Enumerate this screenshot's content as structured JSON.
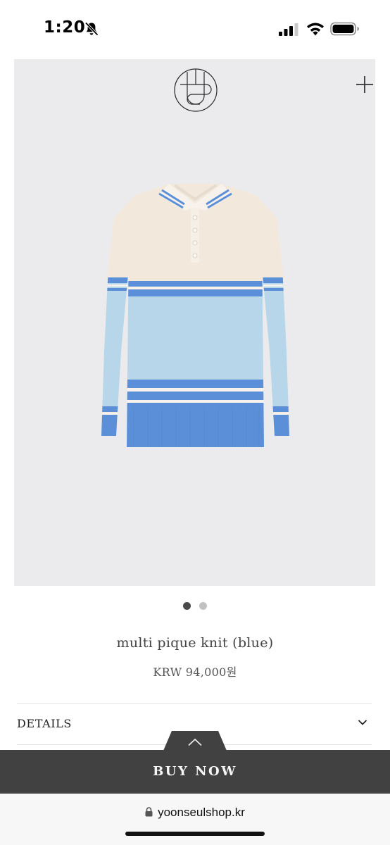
{
  "status_bar": {
    "time": "1:20",
    "icons": [
      "bell-slash-icon",
      "signal-icon",
      "wifi-icon",
      "battery-icon"
    ]
  },
  "product": {
    "image_alt": "multi pique knit (blue)",
    "gallery": {
      "total": 2,
      "active_index": 0
    },
    "name": "multi pique knit (blue)",
    "price": "KRW 94,000원"
  },
  "details": {
    "label": "DETAILS"
  },
  "buy": {
    "label": "BUY NOW"
  },
  "browser": {
    "url": "yoonseulshop.kr"
  },
  "colors": {
    "image_bg": "#ebebed",
    "knit_cream": "#f2e8dc",
    "knit_light_blue": "#b7d6ea",
    "knit_blue": "#5b90d8",
    "buy_bar": "#414141"
  }
}
